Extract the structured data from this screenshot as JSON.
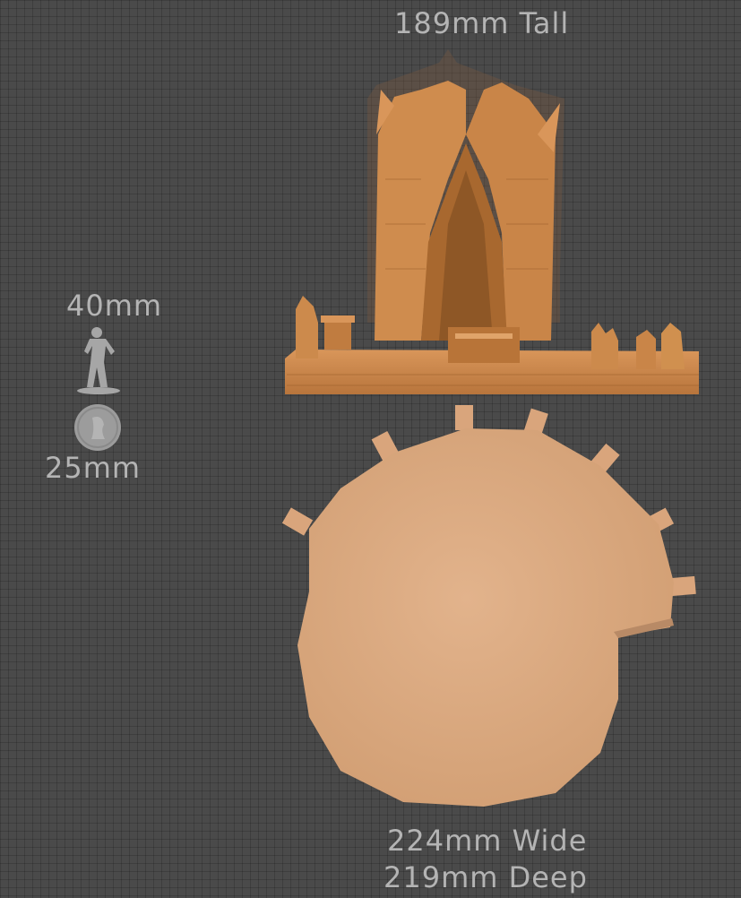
{
  "labels": {
    "height": "189mm Tall",
    "miniature_height": "40mm",
    "base_size": "25mm",
    "width": "224mm Wide",
    "depth": "219mm Deep"
  },
  "colors": {
    "background": "#4a4a4a",
    "model_front": "#c98548",
    "model_top": "#dcaa82",
    "miniature": "#a6a6a6",
    "label_text": "#b4b4b4"
  }
}
